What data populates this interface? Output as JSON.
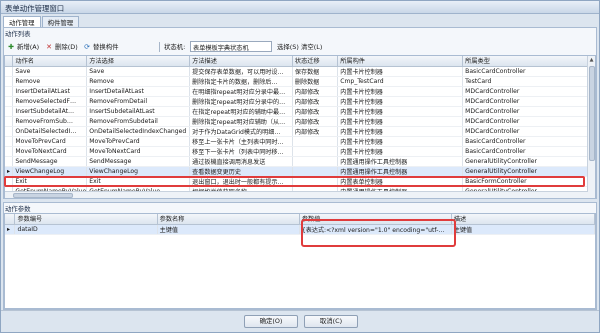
{
  "window": {
    "title": "表单动作管理窗口"
  },
  "tabs": [
    {
      "label": "动作管理",
      "active": true
    },
    {
      "label": "构件管理",
      "active": false
    }
  ],
  "action_list": {
    "section_title": "动作列表",
    "toolbar": {
      "add_label": "新增(A)",
      "delete_label": "删除(D)",
      "replace_label": "替换构件",
      "state_label": "状态机:",
      "state_value": "表单模板字典状态机",
      "select_label": "选择(S)",
      "clear_label": "清空(L)"
    },
    "columns": [
      "动作名",
      "方法选择",
      "方法描述",
      "状态迁移",
      "所属构件",
      "所属类型"
    ],
    "rows": [
      [
        "Save",
        "Save",
        "提交保存表单数据，可以用时设…",
        "保存数据",
        "内置卡片控制器",
        "BasicCardController"
      ],
      [
        "Remove",
        "Remove",
        "删除指定卡片的数据，删除后…",
        "删除数据",
        "Cmp_TestCard",
        "TestCard"
      ],
      [
        "InsertDetailAtLast",
        "InsertDetailAtLast",
        "在明细指repeat明对应分录中最…",
        "内部修改",
        "内置卡片控制器",
        "MDCardController"
      ],
      [
        "RemoveSelectedF…",
        "RemoveFromDetail",
        "删除指定repeat明对应分录中的…",
        "内部修改",
        "内置卡片控制器",
        "MDCardController"
      ],
      [
        "InsertSubdetailAt…",
        "InsertSubdetailAtLast",
        "在指定repeat明对应的辅助中最…",
        "内部修改",
        "内置卡片控制器",
        "MDCardController"
      ],
      [
        "RemoveFromSub…",
        "RemoveFromSubdetail",
        "删除指定repeat明对应辅助（从…",
        "内部修改",
        "内置卡片控制器",
        "MDCardController"
      ],
      [
        "OnDetailSelectedI…",
        "OnDetailSelectedIndexChanged",
        "对于作为DataGrid模式的明细…",
        "内部修改",
        "内置卡片控制器",
        "MDCardController"
      ],
      [
        "MoveToPrevCard",
        "MoveToPrevCard",
        "移至上一张卡片（主列表中同时…",
        "",
        "内置卡片控制器",
        "BasicCardController"
      ],
      [
        "MoveToNextCard",
        "MoveToNextCard",
        "移至下一张卡片（列表中同时移…",
        "",
        "内置卡片控制器",
        "BasicCardController"
      ],
      [
        "SendMessage",
        "SendMessage",
        "通过扳機直接调用消息发送",
        "",
        "内置通用操作工具控制器",
        "GeneralUtilityController"
      ],
      [
        "ViewChangeLog",
        "ViewChangeLog",
        "查看数据变更历史",
        "",
        "内置通用操作工具控制器",
        "GeneralUtilityController"
      ],
      [
        "Exit",
        "Exit",
        "退出窗口，退出时一般都有提示…",
        "",
        "内置表单控制器",
        "BasicFormController"
      ],
      [
        "GetEnumNameByValue",
        "GetEnumNameByValue",
        "根据枚举值获取名称",
        "",
        "内置通用操作工具控制器",
        "GeneralUtilityController"
      ]
    ],
    "selected_row": 10
  },
  "action_params": {
    "section_title": "动作参数",
    "columns": [
      "参数编号",
      "参数名称",
      "参数值",
      "描述"
    ],
    "rows": [
      [
        "dataID",
        "主键值",
        "{表达式:<?xml version=\"1.0\" encoding=\"utf-…",
        "主键值"
      ]
    ]
  },
  "buttons": {
    "ok_label": "确定(O)",
    "cancel_label": "取消(C)"
  },
  "colors": {
    "highlight": "#e03c3c",
    "selection": "#dce9fb"
  }
}
